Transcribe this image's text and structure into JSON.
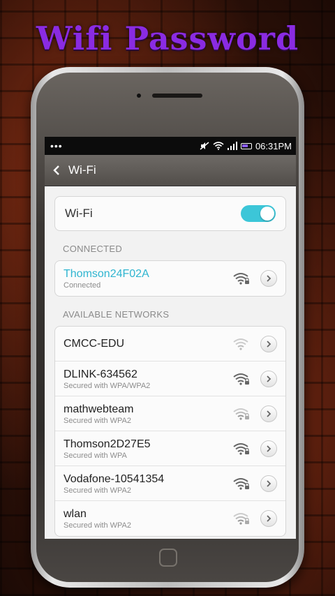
{
  "promo": {
    "title": "Wifi Password"
  },
  "statusbar": {
    "time": "06:31PM",
    "left_icons": "•••"
  },
  "appbar": {
    "title": "Wi-Fi"
  },
  "wifi_toggle": {
    "label": "Wi-Fi",
    "on": true
  },
  "connected": {
    "header": "CONNECTED",
    "network": {
      "name": "Thomson24F02A",
      "status": "Connected"
    }
  },
  "available": {
    "header": "AVAILABLE NETWORKS",
    "networks": [
      {
        "name": "CMCC-EDU",
        "security": "",
        "signal": "weak",
        "locked": false
      },
      {
        "name": "DLINK-634562",
        "security": "Secured with WPA/WPA2",
        "signal": "strong",
        "locked": true
      },
      {
        "name": "mathwebteam",
        "security": "Secured with WPA2",
        "signal": "weak",
        "locked": true
      },
      {
        "name": "Thomson2D27E5",
        "security": "Secured with WPA",
        "signal": "strong",
        "locked": true
      },
      {
        "name": "Vodafone-10541354",
        "security": "Secured with WPA2",
        "signal": "strong",
        "locked": true
      },
      {
        "name": "wlan",
        "security": "Secured with WPA2",
        "signal": "weak",
        "locked": true
      }
    ]
  },
  "colors": {
    "accent": "#2fb5d0",
    "promo": "#8a2be2",
    "toggle": "#3cc6d8"
  }
}
